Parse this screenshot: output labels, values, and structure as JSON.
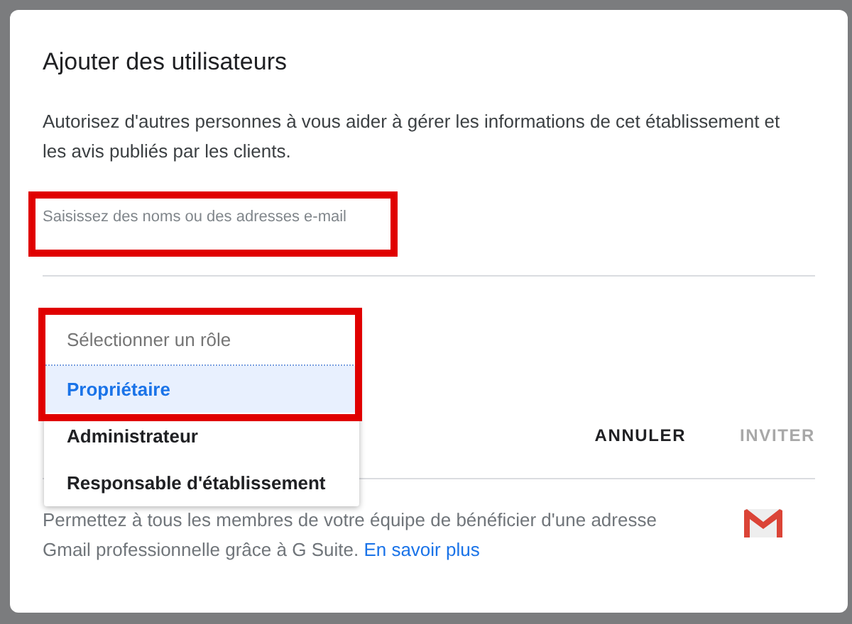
{
  "dialog": {
    "title": "Ajouter des utilisateurs",
    "description": "Autorisez d'autres personnes à vous aider à gérer les informations de cet établissement et les avis publiés par les clients.",
    "email_field": {
      "placeholder": "Saisissez des noms ou des adresses e-mail"
    },
    "role_menu": {
      "header": "Sélectionner un rôle",
      "options": [
        {
          "label": "Propriétaire",
          "selected": true
        },
        {
          "label": "Administrateur",
          "selected": false
        },
        {
          "label": "Responsable d'établissement",
          "selected": false
        }
      ]
    },
    "buttons": [
      {
        "label": "ANNULER",
        "disabled": false
      },
      {
        "label": "INVITER",
        "disabled": true
      }
    ],
    "footer": {
      "text": "Permettez à tous les membres de votre équipe de bénéficier d'une adresse Gmail professionnelle grâce à G Suite.",
      "link": "En savoir plus"
    }
  }
}
